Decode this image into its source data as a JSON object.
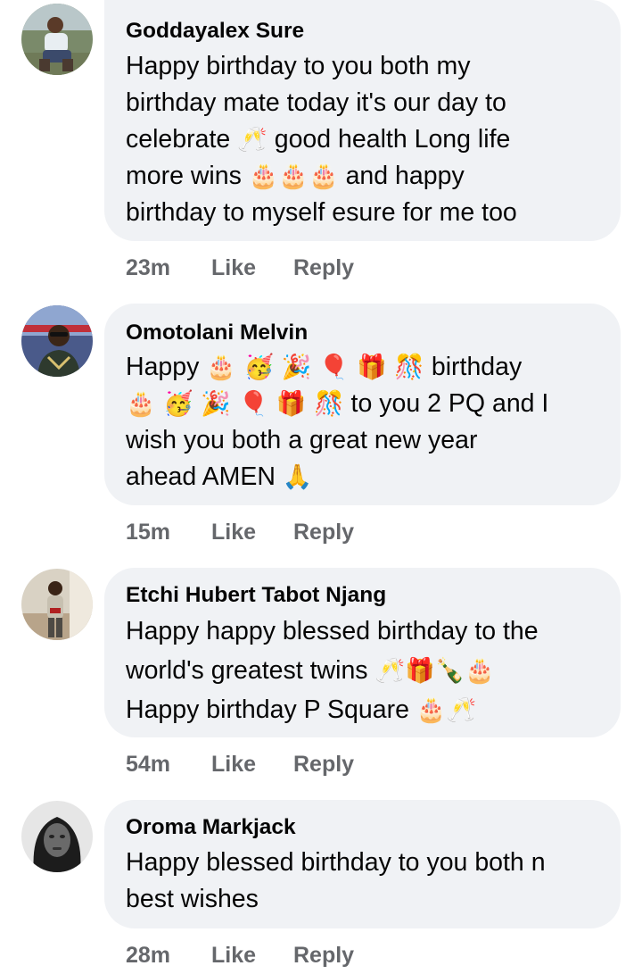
{
  "comments": [
    {
      "author": "Goddayalex Sure",
      "lines": [
        [
          "Happy birthday to you both my"
        ],
        [
          "birthday mate today it's our day to"
        ],
        [
          "celebrate ",
          "🥂",
          " good health Long life"
        ],
        [
          "more wins ",
          "🎂🎂🎂",
          " and happy"
        ],
        [
          "birthday to myself esure for me too"
        ]
      ],
      "time": "23m",
      "like_label": "Like",
      "reply_label": "Reply",
      "avatar_icon": "profile-photo-man-sitting"
    },
    {
      "author": "Omotolani Melvin",
      "lines": [
        [
          "Happy ",
          "🎂 🥳 🎉 🎈 🎁 🎊",
          " birthday"
        ],
        [
          "🎂 🥳 🎉 🎈 🎁 🎊",
          " to you 2 PQ and I"
        ],
        [
          "wish you both a great new year"
        ],
        [
          "ahead AMEN ",
          "🙏"
        ]
      ],
      "time": "15m",
      "like_label": "Like",
      "reply_label": "Reply",
      "avatar_icon": "profile-photo-man-glasses"
    },
    {
      "author": "Etchi Hubert Tabot Njang",
      "lines": [
        [
          "Happy happy blessed birthday to the"
        ],
        [
          "world's greatest twins ",
          "🥂🎁🍾🎂"
        ],
        [
          "Happy birthday P Square ",
          "🎂🥂"
        ]
      ],
      "time": "54m",
      "like_label": "Like",
      "reply_label": "Reply",
      "avatar_icon": "profile-photo-man-standing"
    },
    {
      "author": "Oroma Markjack",
      "lines": [
        [
          "Happy blessed birthday to you both n"
        ],
        [
          "best wishes"
        ]
      ],
      "time": "28m",
      "like_label": "Like",
      "reply_label": "Reply",
      "avatar_icon": "profile-photo-woman"
    }
  ]
}
